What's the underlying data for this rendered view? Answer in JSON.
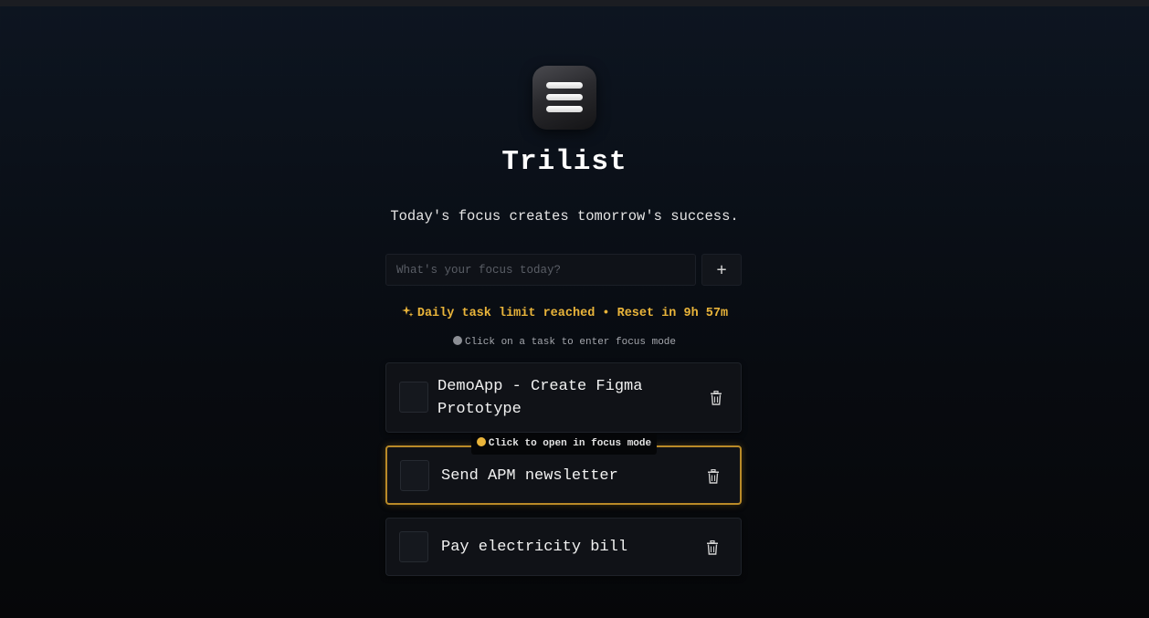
{
  "app": {
    "title": "Trilist",
    "tagline": "Today's focus creates tomorrow's success."
  },
  "input": {
    "placeholder": "What's your focus today?",
    "value": ""
  },
  "add_button": {
    "label": "+"
  },
  "limit_notice": {
    "text": "Daily task limit reached • Reset in 9h 57m",
    "color": "#e9b43a"
  },
  "hint": {
    "text": "Click on a task to enter focus mode"
  },
  "tooltip": {
    "text": "Click to open in focus mode"
  },
  "tasks": [
    {
      "line1": "DemoApp - Create Figma",
      "line2": "Prototype"
    },
    {
      "line1": "Send APM newsletter"
    },
    {
      "line1": "Pay electricity bill"
    }
  ],
  "colors": {
    "accent": "#e9b43a",
    "active_border": "#b98a28",
    "background": "#070b12"
  },
  "icons": {
    "logo": "menu-lines-icon",
    "delete": "trash-icon",
    "spark": "sparkle-icon"
  }
}
